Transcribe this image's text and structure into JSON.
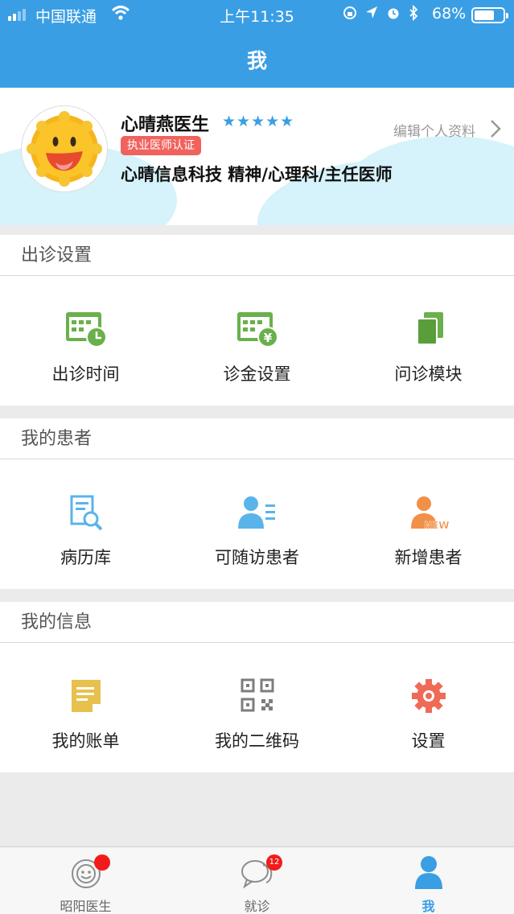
{
  "status_bar": {
    "carrier": "中国联通",
    "time": "上午11:35",
    "battery": "68%"
  },
  "nav": {
    "title": "我"
  },
  "profile": {
    "name": "心晴燕医生",
    "stars": "★★★★★",
    "rating": 5,
    "certification": "执业医师认证",
    "title_line": "心晴信息科技 精神/心理科/主任医师",
    "edit_link": "编辑个人资料"
  },
  "sections": {
    "clinic": {
      "title": "出诊设置",
      "items": [
        {
          "label": "出诊时间",
          "icon": "calendar-clock-icon"
        },
        {
          "label": "诊金设置",
          "icon": "calendar-yen-icon"
        },
        {
          "label": "问诊模块",
          "icon": "stacked-pages-icon"
        }
      ]
    },
    "patients": {
      "title": "我的患者",
      "items": [
        {
          "label": "病历库",
          "icon": "record-search-icon"
        },
        {
          "label": "可随访患者",
          "icon": "patient-list-icon"
        },
        {
          "label": "新增患者",
          "icon": "new-patient-icon",
          "tag": "NEW"
        }
      ]
    },
    "info": {
      "title": "我的信息",
      "items": [
        {
          "label": "我的账单",
          "icon": "bill-icon"
        },
        {
          "label": "我的二维码",
          "icon": "qr-code-icon"
        },
        {
          "label": "设置",
          "icon": "gear-icon"
        }
      ]
    }
  },
  "tab_bar": {
    "tabs": [
      {
        "label": "昭阳医生",
        "icon": "sun-avatar-icon"
      },
      {
        "label": "就诊",
        "icon": "chat-bubbles-icon",
        "badge": "12"
      },
      {
        "label": "我",
        "icon": "person-icon",
        "active": true
      }
    ]
  },
  "colors": {
    "accent": "#3a9ee4",
    "green": "#6ab04c",
    "orange": "#f19047",
    "badge": "#f21b1b",
    "cert": "#f0625d"
  }
}
